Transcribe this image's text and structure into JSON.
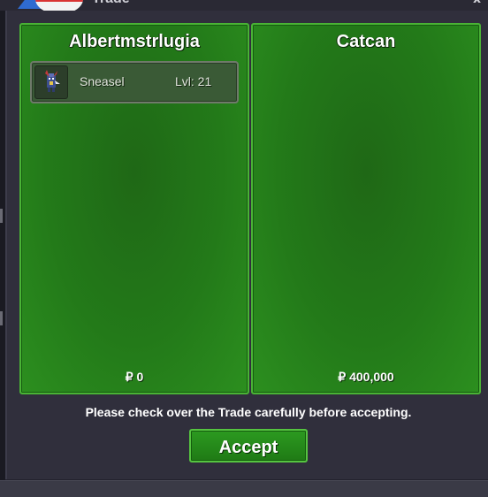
{
  "window": {
    "title": "Trade",
    "close_label": "x"
  },
  "left_panel": {
    "trainer_name": "Albertmstrlugia",
    "items": [
      {
        "icon": "sneasel-sprite-icon",
        "name": "Sneasel",
        "level": "Lvl: 21"
      }
    ],
    "money": "₽ 0"
  },
  "right_panel": {
    "trainer_name": "Catcan",
    "items": [],
    "money": "₽ 400,000"
  },
  "notice": "Please check over the Trade carefully before accepting.",
  "accept_label": "Accept",
  "colors": {
    "panel_green": "#237a19",
    "border_green": "#49b335",
    "frame": "#302f3c"
  }
}
